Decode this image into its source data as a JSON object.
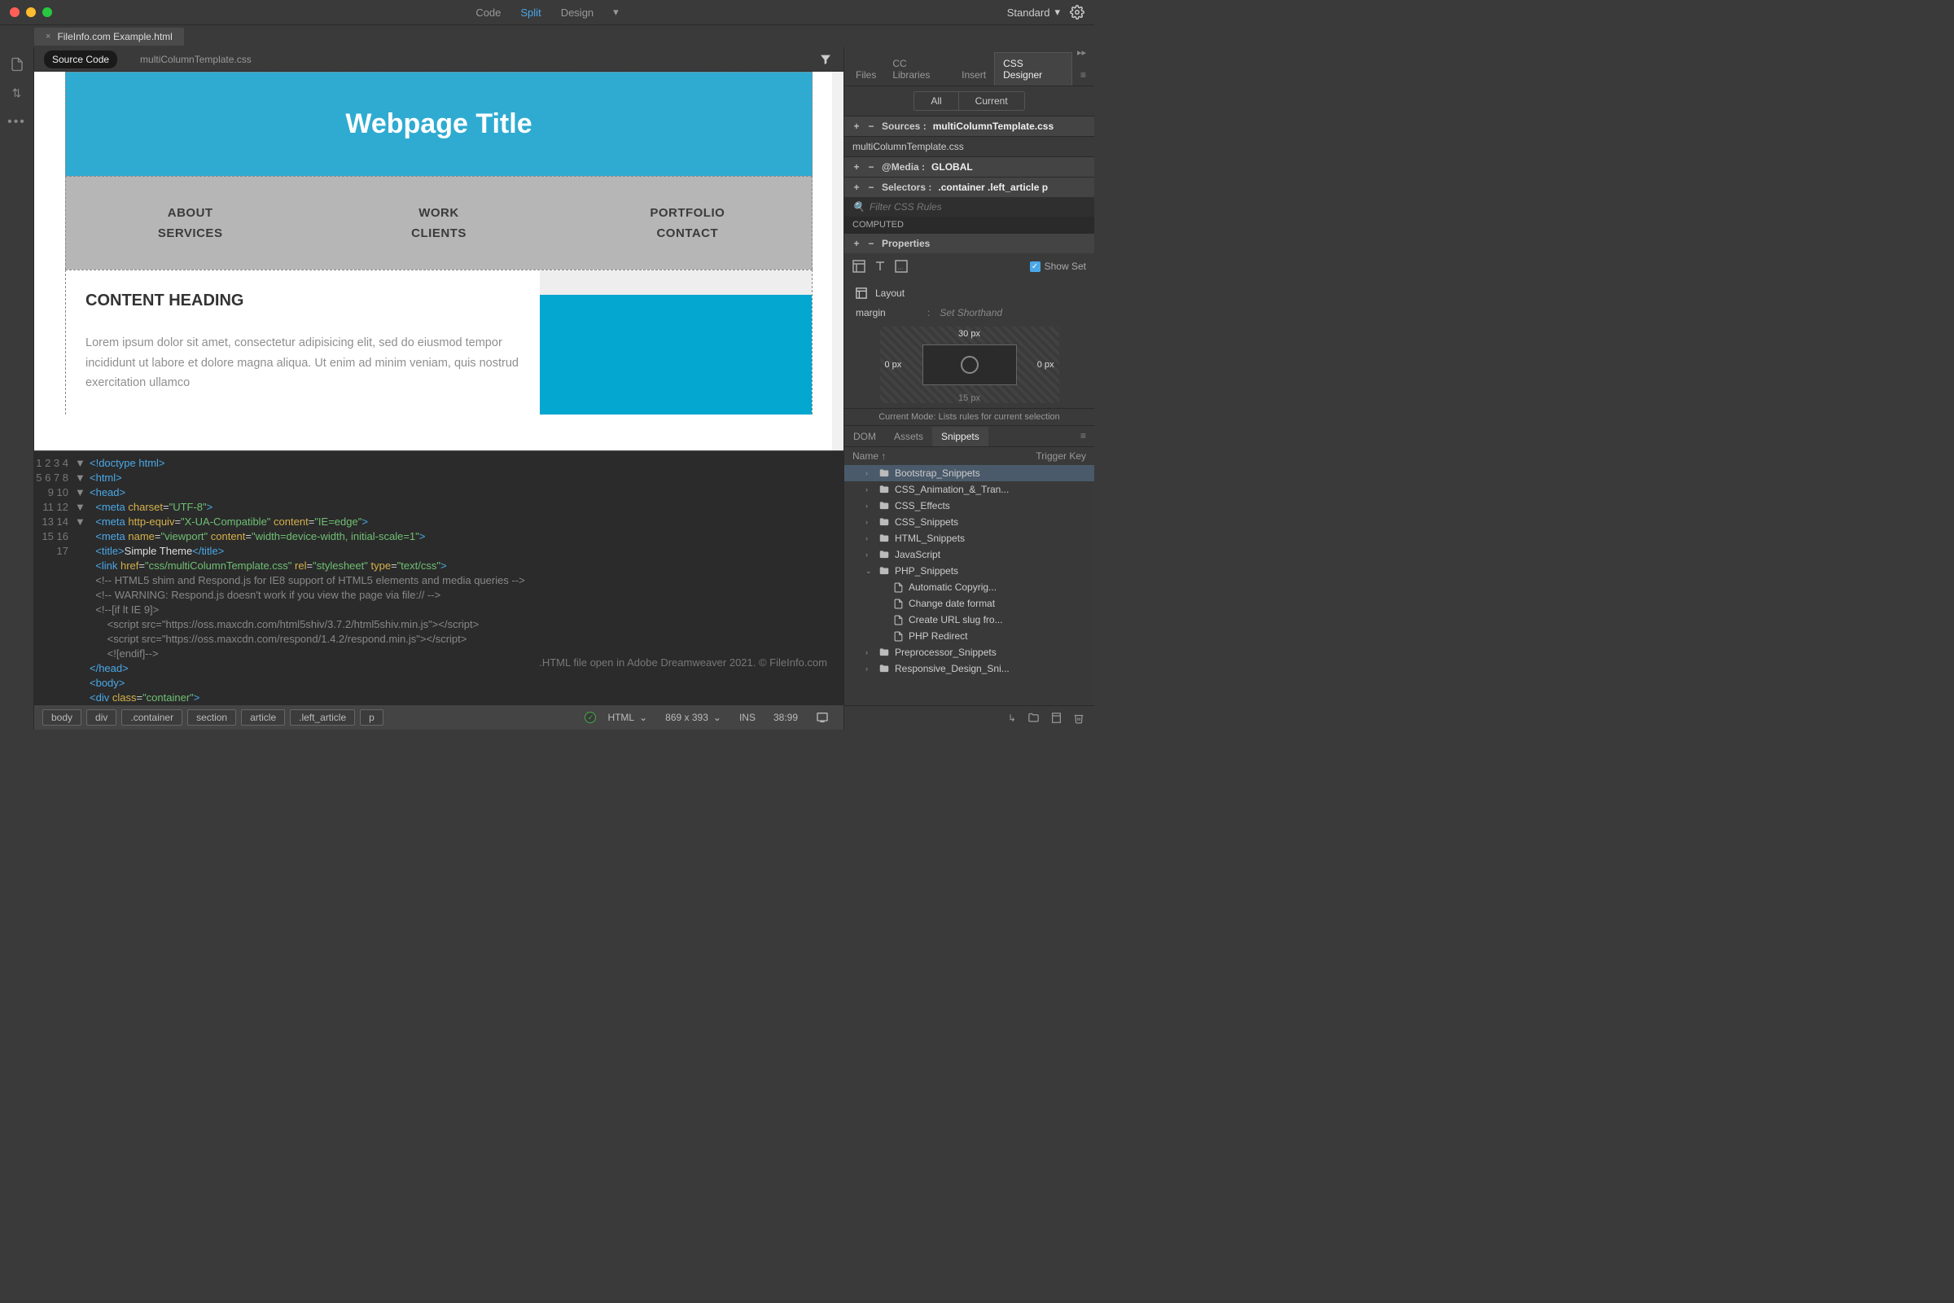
{
  "titlebar": {
    "viewTabs": [
      "Code",
      "Split",
      "Design"
    ],
    "activeView": "Split",
    "workspace": "Standard"
  },
  "fileTab": {
    "name": "FileInfo.com Example.html"
  },
  "subTabs": {
    "source": "Source Code",
    "css": "multiColumnTemplate.css"
  },
  "preview": {
    "heroTitle": "Webpage Title",
    "navRow1": [
      "ABOUT",
      "WORK",
      "PORTFOLIO"
    ],
    "navRow2": [
      "SERVICES",
      "CLIENTS",
      "CONTACT"
    ],
    "contentHeading": "CONTENT HEADING",
    "contentBody": "Lorem ipsum dolor sit amet, consectetur adipisicing elit, sed do eiusmod tempor incididunt ut labore et dolore magna aliqua. Ut enim ad minim veniam, quis nostrud exercitation ullamco"
  },
  "code": {
    "lines": [
      {
        "n": 1,
        "fold": "",
        "html": "<span class='tok-tag'>&lt;!doctype html&gt;</span>"
      },
      {
        "n": 2,
        "fold": "▼",
        "html": "<span class='tok-tag'>&lt;html&gt;</span>"
      },
      {
        "n": 3,
        "fold": "▼",
        "html": "<span class='tok-tag'>&lt;head&gt;</span>"
      },
      {
        "n": 4,
        "fold": "",
        "html": "  <span class='tok-tag'>&lt;meta</span> <span class='tok-attr'>charset</span>=<span class='tok-str'>\"UTF-8\"</span><span class='tok-tag'>&gt;</span>"
      },
      {
        "n": 5,
        "fold": "",
        "html": "  <span class='tok-tag'>&lt;meta</span> <span class='tok-attr'>http-equiv</span>=<span class='tok-str'>\"X-UA-Compatible\"</span> <span class='tok-attr'>content</span>=<span class='tok-str'>\"IE=edge\"</span><span class='tok-tag'>&gt;</span>"
      },
      {
        "n": 6,
        "fold": "",
        "html": "  <span class='tok-tag'>&lt;meta</span> <span class='tok-attr'>name</span>=<span class='tok-str'>\"viewport\"</span> <span class='tok-attr'>content</span>=<span class='tok-str'>\"width=device-width, initial-scale=1\"</span><span class='tok-tag'>&gt;</span>"
      },
      {
        "n": 7,
        "fold": "",
        "html": "  <span class='tok-tag'>&lt;title&gt;</span><span class='tok-txt'>Simple Theme</span><span class='tok-tag'>&lt;/title&gt;</span>"
      },
      {
        "n": 8,
        "fold": "",
        "html": "  <span class='tok-tag'>&lt;link</span> <span class='tok-attr'>href</span>=<span class='tok-str'>\"css/multiColumnTemplate.css\"</span> <span class='tok-attr'>rel</span>=<span class='tok-str'>\"stylesheet\"</span> <span class='tok-attr'>type</span>=<span class='tok-str'>\"text/css\"</span><span class='tok-tag'>&gt;</span>"
      },
      {
        "n": 9,
        "fold": "",
        "html": "  <span class='tok-cm'>&lt;!-- HTML5 shim and Respond.js for IE8 support of HTML5 elements and media queries --&gt;</span>"
      },
      {
        "n": 10,
        "fold": "",
        "html": "  <span class='tok-cm'>&lt;!-- WARNING: Respond.js doesn't work if you view the page via file:// --&gt;</span>"
      },
      {
        "n": 11,
        "fold": "▼",
        "html": "  <span class='tok-cm'>&lt;!--[if lt IE 9]&gt;</span>"
      },
      {
        "n": 12,
        "fold": "",
        "html": "      <span class='tok-cm'>&lt;script src=\"https://oss.maxcdn.com/html5shiv/3.7.2/html5shiv.min.js\"&gt;&lt;/script&gt;</span>"
      },
      {
        "n": 13,
        "fold": "",
        "html": "      <span class='tok-cm'>&lt;script src=\"https://oss.maxcdn.com/respond/1.4.2/respond.min.js\"&gt;&lt;/script&gt;</span>"
      },
      {
        "n": 14,
        "fold": "",
        "html": "      <span class='tok-cm'>&lt;![endif]--&gt;</span>"
      },
      {
        "n": 15,
        "fold": "",
        "html": "<span class='tok-tag'>&lt;/head&gt;</span>"
      },
      {
        "n": 16,
        "fold": "▼",
        "html": "<span class='tok-tag'>&lt;body&gt;</span>"
      },
      {
        "n": 17,
        "fold": "▼",
        "html": "<span class='tok-tag'>&lt;div</span> <span class='tok-attr'>class</span>=<span class='tok-str'>\"container\"</span><span class='tok-tag'>&gt;</span>"
      }
    ],
    "watermark": ".HTML file open in Adobe Dreamweaver 2021. © FileInfo.com"
  },
  "statusbar": {
    "crumbs": [
      "body",
      "div",
      ".container",
      "section",
      "article",
      ".left_article",
      "p"
    ],
    "lang": "HTML",
    "dims": "869 x 393",
    "insert": "INS",
    "cursor": "38:99"
  },
  "cssDesigner": {
    "tabs": [
      "Files",
      "CC Libraries",
      "Insert",
      "CSS Designer"
    ],
    "activeTab": "CSS Designer",
    "subTabs": {
      "all": "All",
      "current": "Current"
    },
    "sourcesLabel": "Sources :",
    "sourcesValue": "multiColumnTemplate.css",
    "sourceItem": "multiColumnTemplate.css",
    "mediaLabel": "@Media :",
    "mediaValue": "GLOBAL",
    "selectorsLabel": "Selectors :",
    "selectorsValue": ".container .left_article p",
    "filterPlaceholder": "Filter CSS Rules",
    "computed": "COMPUTED",
    "propertiesLabel": "Properties",
    "showSet": "Show Set",
    "layoutLabel": "Layout",
    "marginLabel": "margin",
    "shorthand": "Set Shorthand",
    "marginTop": "30 px",
    "marginLeft": "0 px",
    "marginRight": "0 px",
    "marginBottom": "15 px",
    "modeText": "Current Mode: Lists rules for current selection"
  },
  "snippets": {
    "tabs": [
      "DOM",
      "Assets",
      "Snippets"
    ],
    "activeTab": "Snippets",
    "colName": "Name ↑",
    "colTrigger": "Trigger Key",
    "items": [
      {
        "type": "folder",
        "label": "Bootstrap_Snippets",
        "ind": 0,
        "sel": true,
        "chev": "›"
      },
      {
        "type": "folder",
        "label": "CSS_Animation_&_Tran...",
        "ind": 0,
        "chev": "›"
      },
      {
        "type": "folder",
        "label": "CSS_Effects",
        "ind": 0,
        "chev": "›"
      },
      {
        "type": "folder",
        "label": "CSS_Snippets",
        "ind": 0,
        "chev": "›"
      },
      {
        "type": "folder",
        "label": "HTML_Snippets",
        "ind": 0,
        "chev": "›"
      },
      {
        "type": "folder",
        "label": "JavaScript",
        "ind": 0,
        "chev": "›"
      },
      {
        "type": "folder",
        "label": "PHP_Snippets",
        "ind": 0,
        "chev": "⌄",
        "open": true
      },
      {
        "type": "file",
        "label": "Automatic Copyrig...",
        "ind": 1
      },
      {
        "type": "file",
        "label": "Change date format",
        "ind": 1
      },
      {
        "type": "file",
        "label": "Create URL slug fro...",
        "ind": 1
      },
      {
        "type": "file",
        "label": "PHP Redirect",
        "ind": 1
      },
      {
        "type": "folder",
        "label": "Preprocessor_Snippets",
        "ind": 0,
        "chev": "›"
      },
      {
        "type": "folder",
        "label": "Responsive_Design_Sni...",
        "ind": 0,
        "chev": "›"
      }
    ]
  }
}
